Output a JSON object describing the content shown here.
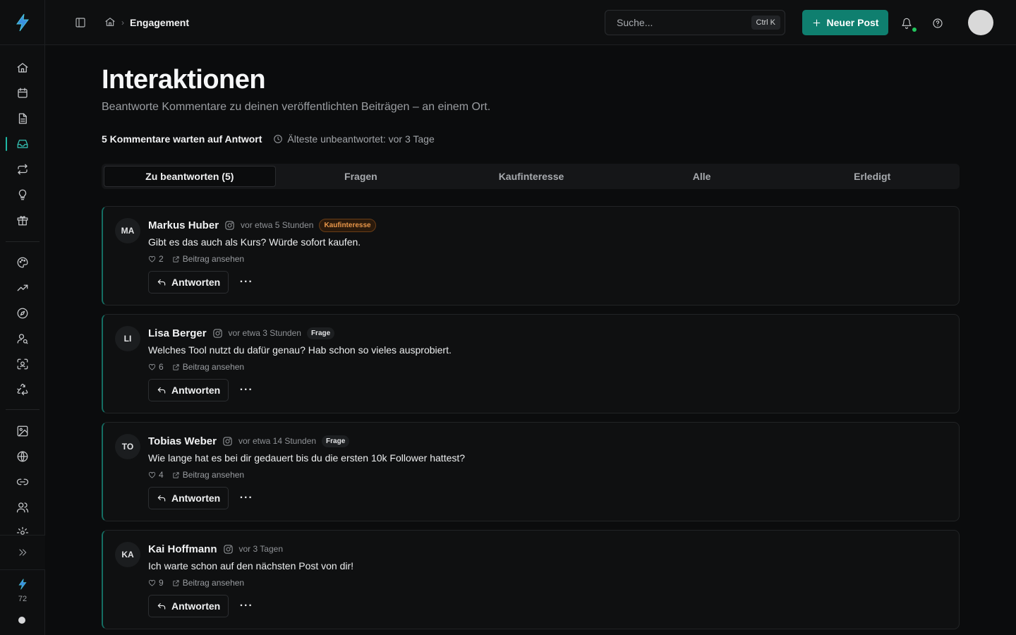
{
  "header": {
    "breadcrumb_current": "Engagement",
    "search_placeholder": "Suche...",
    "search_shortcut": "Ctrl K",
    "new_post_label": "Neuer Post"
  },
  "sidebar": {
    "credits": "72",
    "active_item": "engagement"
  },
  "page": {
    "title": "Interaktionen",
    "subtitle": "Beantworte Kommentare zu deinen veröffentlichten Beiträgen – an einem Ort.",
    "pending": "5 Kommentare warten auf Antwort",
    "oldest": "Älteste unbeantwortet: vor 3 Tage"
  },
  "tabs": [
    {
      "label": "Zu beantworten (5)",
      "active": true
    },
    {
      "label": "Fragen",
      "active": false
    },
    {
      "label": "Kaufinteresse",
      "active": false
    },
    {
      "label": "Alle",
      "active": false
    },
    {
      "label": "Erledigt",
      "active": false
    }
  ],
  "comments": [
    {
      "initials": "MA",
      "name": "Markus Huber",
      "time": "vor etwa 5 Stunden",
      "badge": "Kaufinteresse",
      "text": "Gibt es das auch als Kurs? Würde sofort kaufen.",
      "likes": "2",
      "view_post": "Beitrag ansehen",
      "reply": "Antworten"
    },
    {
      "initials": "LI",
      "name": "Lisa Berger",
      "time": "vor etwa 3 Stunden",
      "badge": "Frage",
      "text": "Welches Tool nutzt du dafür genau? Hab schon so vieles ausprobiert.",
      "likes": "6",
      "view_post": "Beitrag ansehen",
      "reply": "Antworten"
    },
    {
      "initials": "TO",
      "name": "Tobias Weber",
      "time": "vor etwa 14 Stunden",
      "badge": "Frage",
      "text": "Wie lange hat es bei dir gedauert bis du die ersten 10k Follower hattest?",
      "likes": "4",
      "view_post": "Beitrag ansehen",
      "reply": "Antworten"
    },
    {
      "initials": "KA",
      "name": "Kai Hoffmann",
      "time": "vor 3 Tagen",
      "badge": "",
      "text": "Ich warte schon auf den nächsten Post von dir!",
      "likes": "9",
      "view_post": "Beitrag ansehen",
      "reply": "Antworten"
    }
  ],
  "colors": {
    "accent": "#0f7f6f",
    "active_nav": "#34c3b4",
    "buy_badge": "#e9974a",
    "online": "#22c55e"
  }
}
